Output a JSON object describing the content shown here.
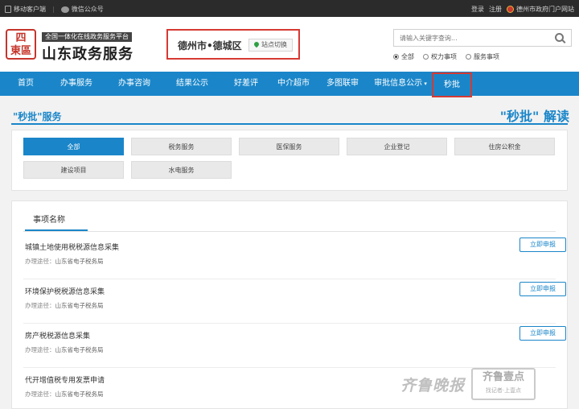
{
  "topbar": {
    "mobile": "移动客户端",
    "wechat": "微信公众号",
    "login": "登录",
    "register": "注册",
    "gov_portal": "德州市政府门户网站"
  },
  "header": {
    "logo_seal": "四\n東區",
    "subtitle": "全国一体化在线政务服务平台",
    "title": "山东政务服务",
    "site_name": "德州市•德城区",
    "site_switch": "站点切换",
    "search_placeholder": "请输入关键字查询...",
    "radios": [
      "全部",
      "权力事项",
      "服务事项"
    ]
  },
  "nav": [
    "首页",
    "办事服务",
    "办事咨询",
    "结果公示",
    "好差评",
    "中介超市",
    "多图联审",
    "审批信息公示",
    "秒批"
  ],
  "section": {
    "title": "\"秒批\"服务",
    "right_quote": "\"秒批\"",
    "right_word": "解读"
  },
  "categories": [
    "全部",
    "税务服务",
    "医保服务",
    "企业登记",
    "住房公积金",
    "建设项目",
    "水电服务"
  ],
  "items_panel": {
    "tab": "事项名称",
    "apply_label": "立即申报",
    "way_label": "办理途径：",
    "items": [
      {
        "name": "城镇土地使用税税源信息采集",
        "way": "山东省电子税务局"
      },
      {
        "name": "环境保护税税源信息采集",
        "way": "山东省电子税务局"
      },
      {
        "name": "房产税税源信息采集",
        "way": "山东省电子税务局"
      },
      {
        "name": "代开增值税专用发票申请",
        "way": "山东省电子税务局"
      }
    ]
  },
  "watermark": {
    "text": "齐鲁晚报",
    "seal_main": "齐鲁壹点",
    "seal_sub": "找记者·上壹点"
  }
}
